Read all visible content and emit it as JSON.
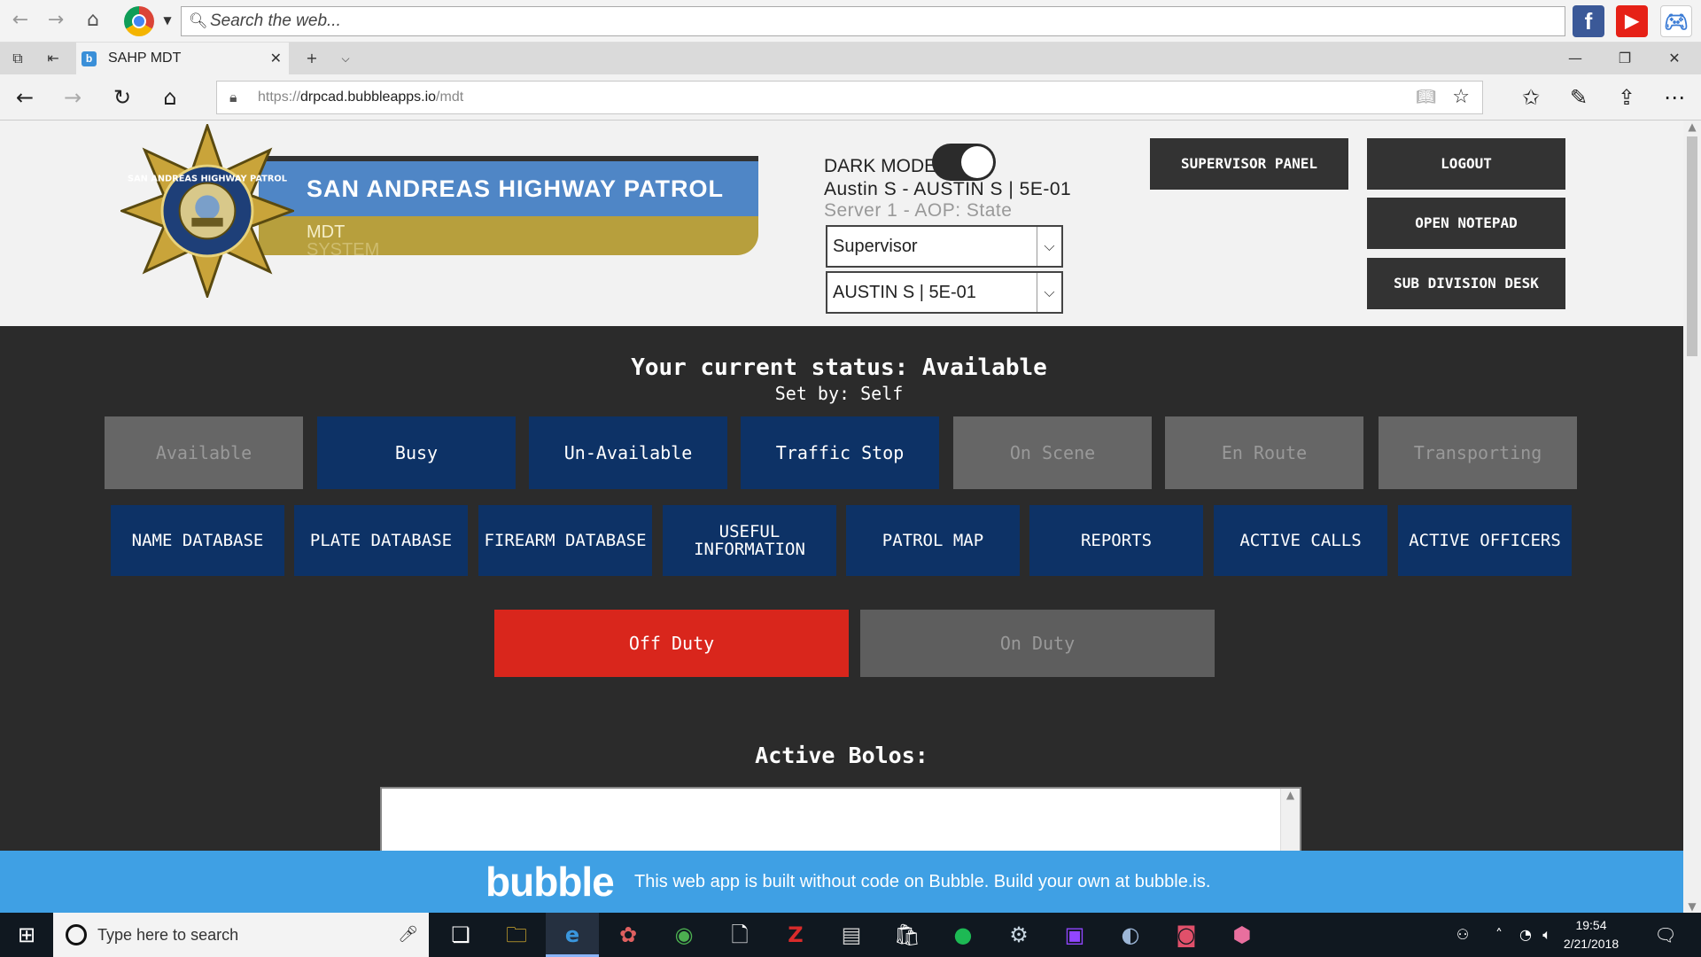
{
  "top_toolbar": {
    "search_placeholder": "Search the web...",
    "search_icon": "magnifier-icon",
    "icons": [
      "back-arrow-icon",
      "forward-arrow-icon",
      "home-icon",
      "chrome-icon",
      "facebook-icon",
      "youtube-icon",
      "gamepad-icon"
    ]
  },
  "browser": {
    "tab_title": "SAHP MDT",
    "tab_favicon": "b",
    "url_protocol": "https://",
    "url_host": "drpcad.bubbleapps.io",
    "url_path": "/mdt",
    "icons": [
      "back-icon",
      "forward-icon",
      "refresh-icon",
      "home-icon",
      "lock-icon",
      "reading-view-icon",
      "favorite-star-icon",
      "favorites-hub-icon",
      "pen-icon",
      "share-icon",
      "more-icon"
    ]
  },
  "header": {
    "agency_name": "SAN ANDREAS HIGHWAY PATROL",
    "subtitle_line1": "MDT",
    "subtitle_line2": "SYSTEM",
    "badge_text": "SAN ANDREAS HIGHWAY PATROL",
    "dark_mode_label": "DARK MODE",
    "dark_mode_on": true,
    "officer_line": "Austin S - AUSTIN S | 5E-01",
    "server_line": "Server 1 - AOP: State",
    "role_select": "Supervisor",
    "unit_select": "AUSTIN S | 5E-01",
    "buttons": {
      "supervisor_panel": "SUPERVISOR PANEL",
      "logout": "LOGOUT",
      "open_notepad": "OPEN NOTEPAD",
      "sub_division_desk": "SUB DIVISION DESK"
    }
  },
  "status": {
    "title": "Your current status: Available",
    "set_by": "Set by: Self",
    "buttons": [
      {
        "label": "Available",
        "enabled": false
      },
      {
        "label": "Busy",
        "enabled": true
      },
      {
        "label": "Un-Available",
        "enabled": true
      },
      {
        "label": "Traffic Stop",
        "enabled": true
      },
      {
        "label": "On Scene",
        "enabled": false
      },
      {
        "label": "En Route",
        "enabled": false
      },
      {
        "label": "Transporting",
        "enabled": false
      }
    ]
  },
  "databases": [
    "NAME DATABASE",
    "PLATE DATABASE",
    "FIREARM DATABASE",
    "USEFUL INFORMATION",
    "PATROL MAP",
    "REPORTS",
    "ACTIVE CALLS",
    "ACTIVE OFFICERS"
  ],
  "duty": {
    "off_label": "Off Duty",
    "on_label": "On Duty",
    "off_color": "#d9261c"
  },
  "bolos": {
    "title": "Active Bolos:"
  },
  "bubble_banner": {
    "logo": "bubble",
    "message": "This web app is built without code on Bubble. Build your own at bubble.is."
  },
  "taskbar": {
    "search_placeholder": "Type here to search",
    "time": "19:54",
    "date": "2/21/2018"
  },
  "colors": {
    "navy": "#0d3266",
    "disabled": "#666666",
    "banner_blue": "#4f86c6",
    "banner_gold": "#b79f3d",
    "bubble_blue": "#3fa0e4",
    "page_dark": "#2b2b2b"
  }
}
